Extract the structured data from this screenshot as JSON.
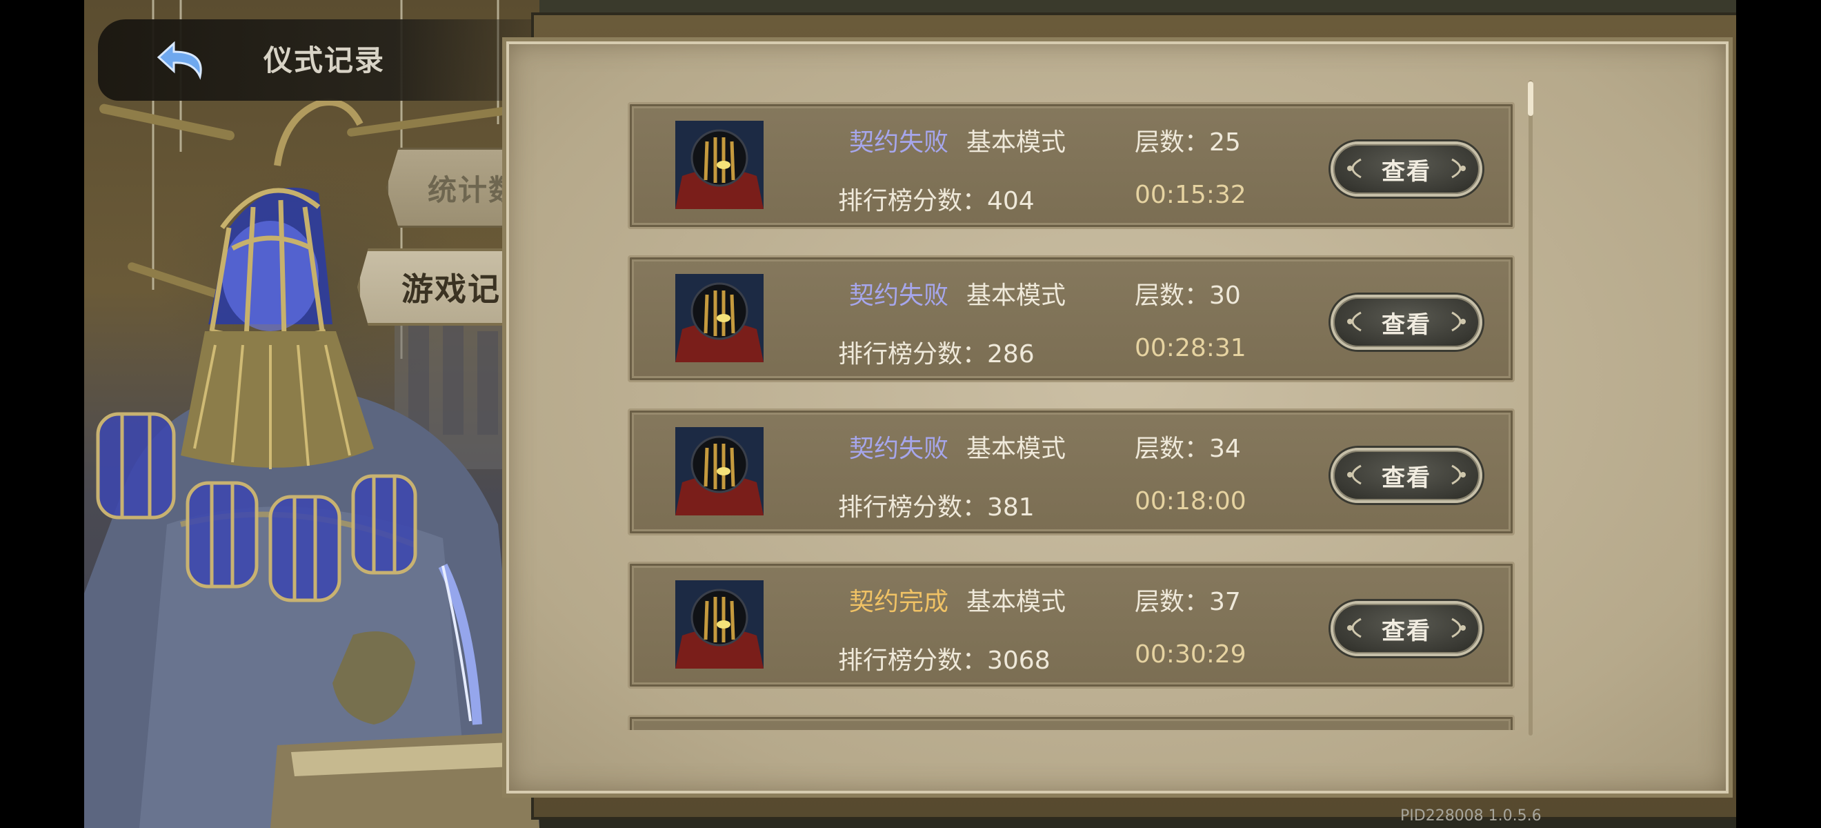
{
  "header": {
    "title": "仪式记录",
    "back_icon": "back-arrow-icon"
  },
  "side_tabs": [
    {
      "label": "统计数据",
      "active": false
    },
    {
      "label": "游戏记录",
      "active": true
    }
  ],
  "records": [
    {
      "status": "契约失败",
      "status_color": "#a6a6ec",
      "mode": "基本模式",
      "floor": "层数：25",
      "score": "排行榜分数：404",
      "time": "00:15:32",
      "view_label": "查看"
    },
    {
      "status": "契约失败",
      "status_color": "#a6a6ec",
      "mode": "基本模式",
      "floor": "层数：30",
      "score": "排行榜分数：286",
      "time": "00:28:31",
      "view_label": "查看"
    },
    {
      "status": "契约失败",
      "status_color": "#a6a6ec",
      "mode": "基本模式",
      "floor": "层数：34",
      "score": "排行榜分数：381",
      "time": "00:18:00",
      "view_label": "查看"
    },
    {
      "status": "契约完成",
      "status_color": "#f0c265",
      "mode": "基本模式",
      "floor": "层数：37",
      "score": "排行榜分数：3068",
      "time": "00:30:29",
      "view_label": "查看"
    }
  ],
  "colors": {
    "panel": "#b6a98b",
    "row": "#7f7257",
    "accent_gold": "#e6d3a1"
  },
  "footer": {
    "version": "PID228008  1.0.5.6"
  }
}
